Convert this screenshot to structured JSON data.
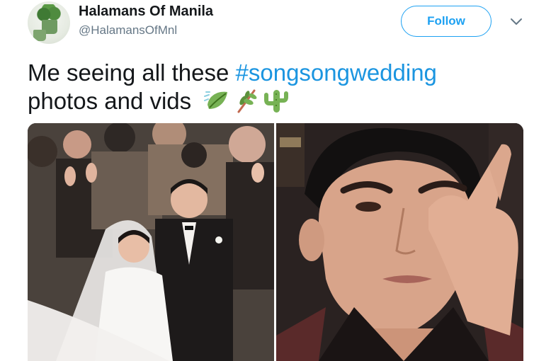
{
  "user": {
    "display_name": "Halamans Of Manila",
    "handle": "@HalamansOfMnl",
    "avatar_icon": "plant-avatar"
  },
  "actions": {
    "follow_label": "Follow",
    "menu_icon": "chevron-down-icon"
  },
  "tweet": {
    "text_line1": "Me seeing all these ",
    "hashtag": "#songsongwedding",
    "text_line2": "photos and vids",
    "emojis": [
      "leaf-fluttering-in-wind",
      "herb",
      "cactus"
    ]
  },
  "media": {
    "items": [
      "wedding-couple-photo",
      "man-wiping-tear-photo"
    ]
  },
  "colors": {
    "accent": "#1da1f2",
    "hashtag": "#1b95e0",
    "secondary_text": "#657786"
  }
}
